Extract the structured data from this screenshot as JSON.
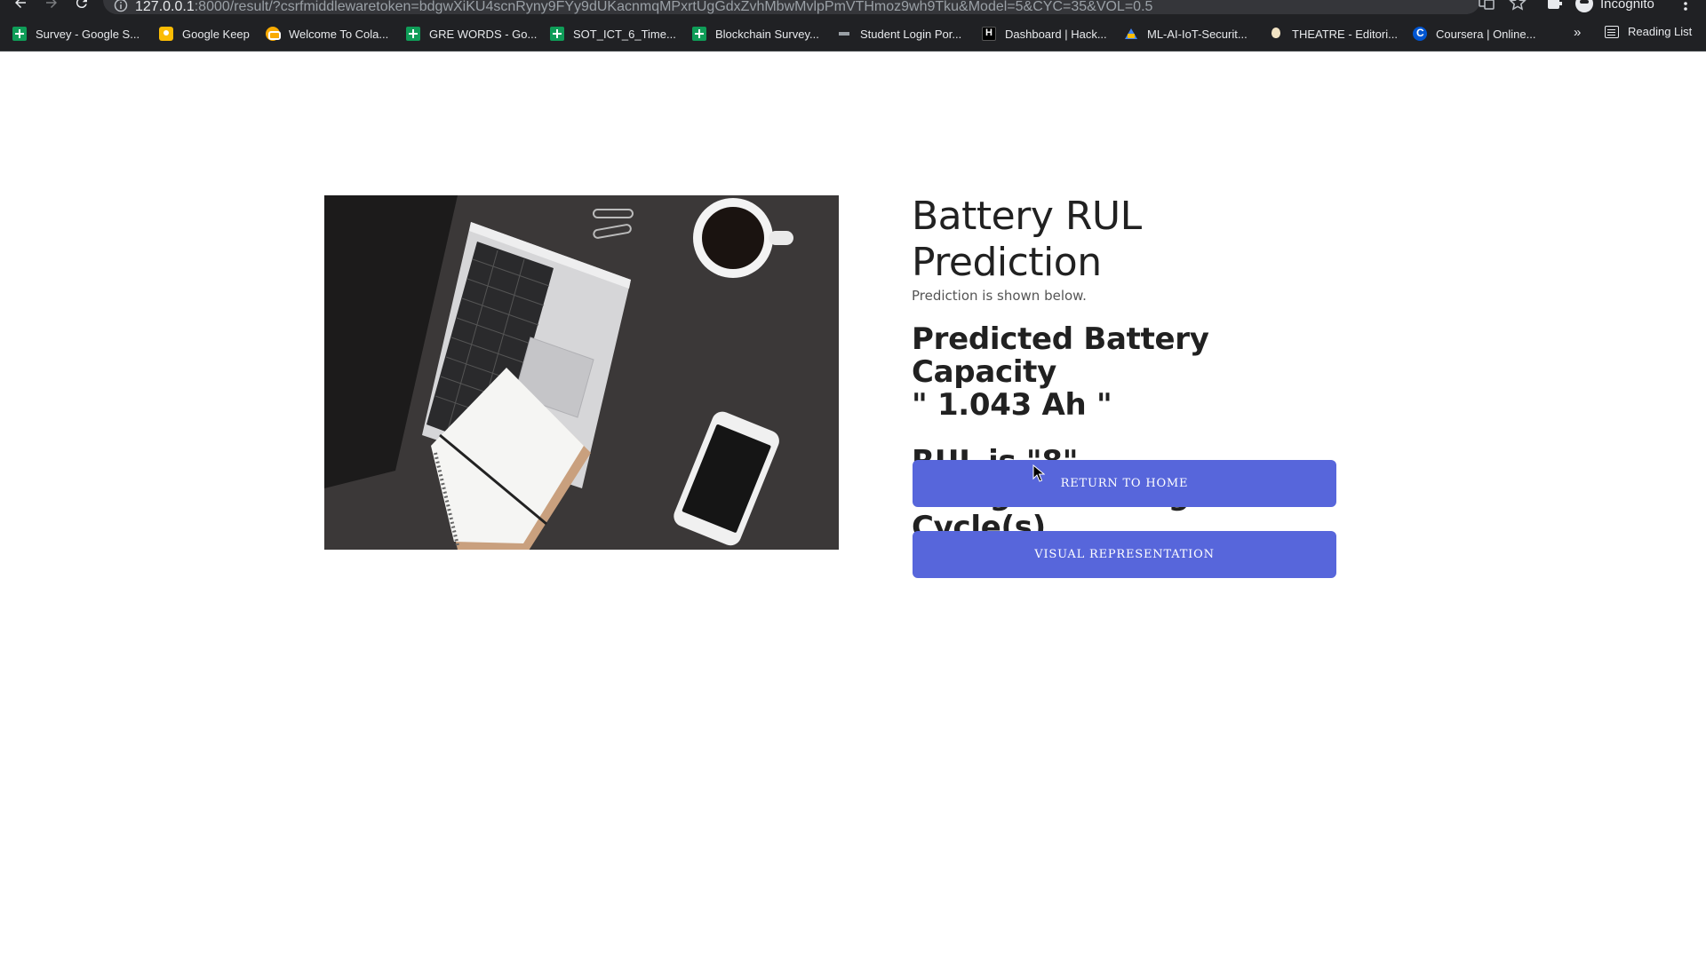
{
  "browser": {
    "url_host": "127.0.0.1",
    "url_rest": ":8000/result/?csrfmiddlewaretoken=bdgwXiKU4scnRyny9FYy9dUKacnmqMPxrtUgGdxZvhMbwMvlpPmVTHmoz9wh9Tku&Model=5&CYC=35&VOL=0.5",
    "profile_label": "Incognito",
    "back_icon": "arrow-left-icon",
    "forward_icon": "arrow-right-icon",
    "reload_icon": "reload-icon"
  },
  "bookmarks": {
    "items": [
      {
        "label": "Survey - Google S...",
        "icon": "sheets-icon"
      },
      {
        "label": "Google Keep",
        "icon": "keep-icon"
      },
      {
        "label": "Welcome To Cola...",
        "icon": "colab-icon"
      },
      {
        "label": "GRE WORDS - Go...",
        "icon": "sheets-icon"
      },
      {
        "label": "SOT_ICT_6_Time...",
        "icon": "sheets-icon"
      },
      {
        "label": "Blockchain Survey...",
        "icon": "sheets-icon"
      },
      {
        "label": "Student Login Por...",
        "icon": "portal-icon"
      },
      {
        "label": "Dashboard | Hack...",
        "icon": "hackerrank-icon"
      },
      {
        "label": "ML-AI-IoT-Securit...",
        "icon": "drive-icon"
      },
      {
        "label": "THEATRE - Editori...",
        "icon": "theatre-icon"
      },
      {
        "label": "Coursera | Online...",
        "icon": "coursera-icon"
      }
    ],
    "more_label": "»",
    "reading_list_label": "Reading List"
  },
  "page": {
    "title": "Battery RUL Prediction",
    "subtitle": "Prediction is shown below.",
    "capacity_line1": "Predicted Battery Capacity",
    "capacity_line2": "\" 1.043 Ah \"",
    "rul_line1": "RUL is \"8\" Charge/Discharge",
    "rul_line2": "Cycle(s)",
    "home_button": "RETURN TO HOME",
    "visual_button": "VISUAL REPRESENTATION",
    "image_name": "desk-laptop-coffee-phone-image"
  },
  "colors": {
    "button": "#5766db",
    "chrome": "#202124"
  }
}
